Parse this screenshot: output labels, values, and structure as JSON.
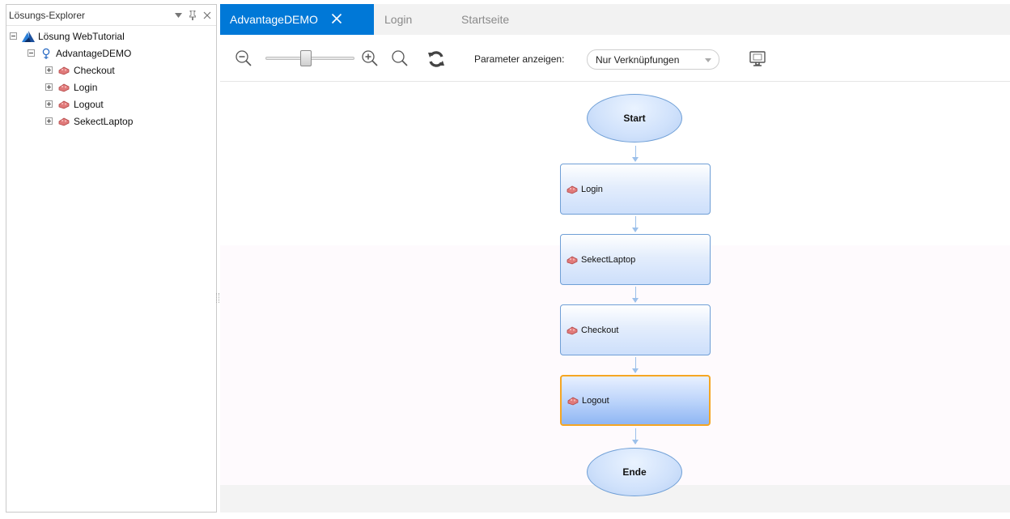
{
  "explorer": {
    "title": "Lösungs-Explorer",
    "header_icons": [
      "dropdown-arrow-icon",
      "pin-icon",
      "close-icon"
    ],
    "tree": {
      "solution_label": "Lösung WebTutorial",
      "test_label": "AdvantageDEMO",
      "actions": [
        {
          "label": "Checkout"
        },
        {
          "label": "Login"
        },
        {
          "label": "Logout"
        },
        {
          "label": "SekectLaptop"
        }
      ]
    }
  },
  "tabs": [
    {
      "label": "AdvantageDEMO",
      "active": true,
      "closable": true
    },
    {
      "label": "Login",
      "active": false
    },
    {
      "label": "Startseite",
      "active": false
    }
  ],
  "toolbar": {
    "zoom_level_fraction": 0.45,
    "parameter_label": "Parameter anzeigen:",
    "parameter_value": "Nur Verknüpfungen",
    "icons": [
      "zoom-out-icon",
      "zoom-in-icon",
      "zoom-fit-icon",
      "refresh-icon",
      "monitor-icon"
    ]
  },
  "flow": {
    "start_label": "Start",
    "end_label": "Ende",
    "steps": [
      {
        "label": "Login",
        "selected": false
      },
      {
        "label": "SekectLaptop",
        "selected": false
      },
      {
        "label": "Checkout",
        "selected": false
      },
      {
        "label": "Logout",
        "selected": true
      }
    ]
  },
  "colors": {
    "accent": "#0078d7",
    "selection": "#f5a623",
    "node_border": "#6f9fd6"
  }
}
